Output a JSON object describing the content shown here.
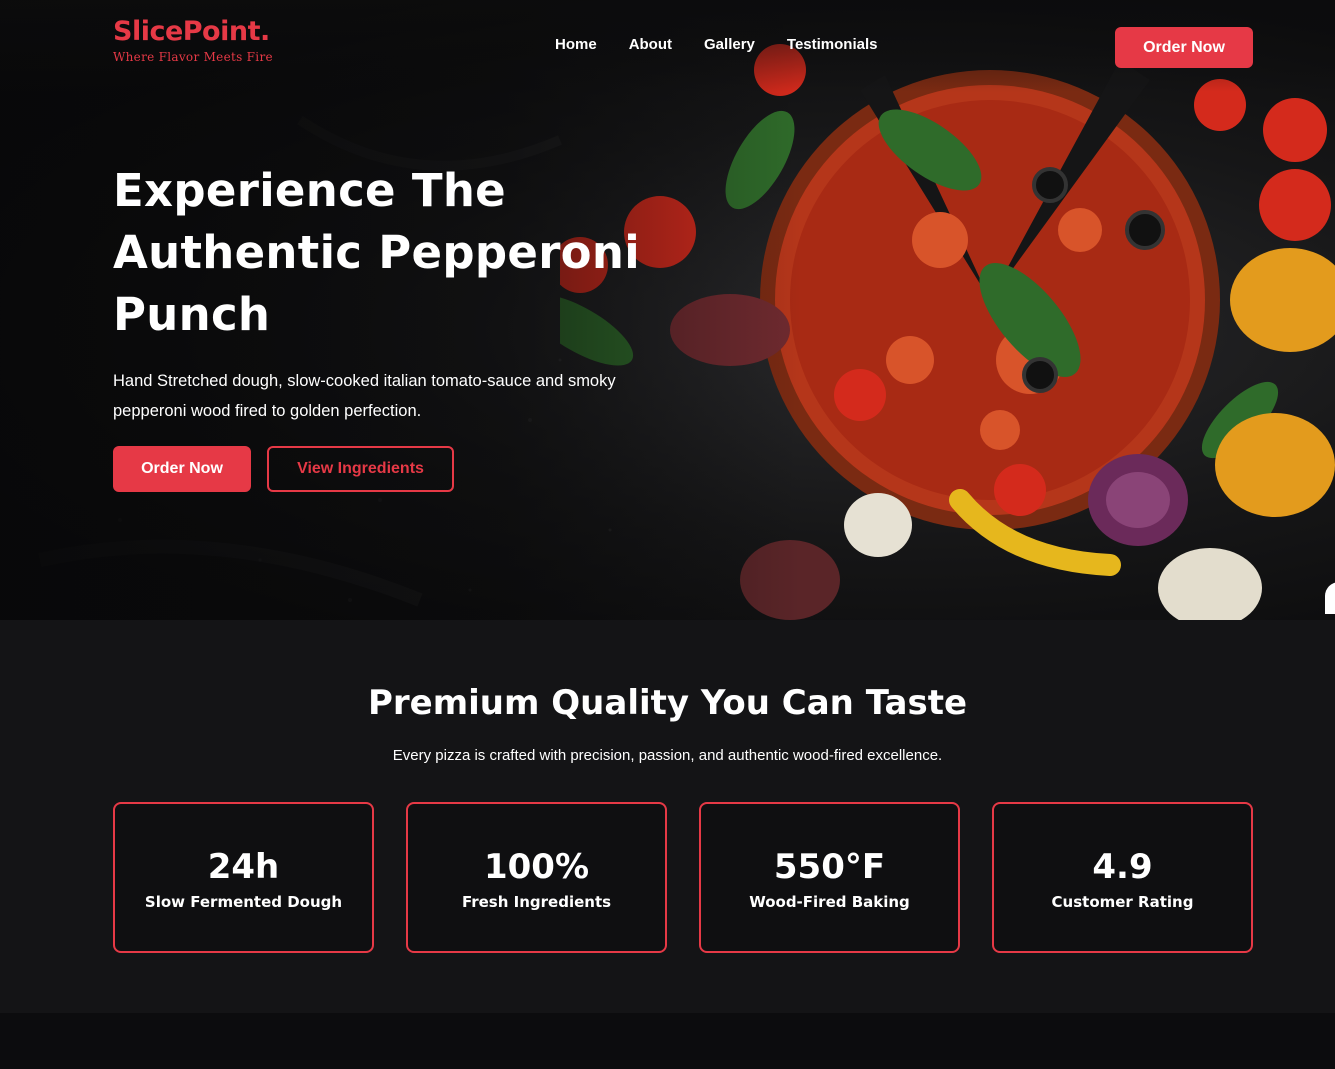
{
  "brand": {
    "name": "SlicePoint.",
    "tagline": "Where Flavor Meets Fire"
  },
  "nav": {
    "links": [
      "Home",
      "About",
      "Gallery",
      "Testimonials"
    ],
    "cta_label": "Order Now"
  },
  "hero": {
    "title_lines": [
      "Experience The",
      "Authentic Pepperoni",
      "Punch"
    ],
    "subtitle_lines": [
      "Hand Stretched dough, slow-cooked italian tomato-sauce and smoky",
      "pepperoni wood fired to golden perfection."
    ],
    "primary_label": "Order Now",
    "secondary_label": "View Ingredients",
    "image": "pizza-ingredients-photo"
  },
  "features": {
    "title": "Premium Quality You Can Taste",
    "subtitle": "Every pizza is crafted with precision, passion, and authentic wood-fired excellence.",
    "stats": [
      {
        "value": "24h",
        "label": "Slow Fermented Dough"
      },
      {
        "value": "100%",
        "label": "Fresh Ingredients"
      },
      {
        "value": "550°F",
        "label": "Wood-Fired Baking"
      },
      {
        "value": "4.9",
        "label": "Customer Rating"
      }
    ]
  },
  "colors": {
    "accent": "#e63946",
    "background": "#141416",
    "card_background": "#0f0f11",
    "text": "#ffffff"
  }
}
